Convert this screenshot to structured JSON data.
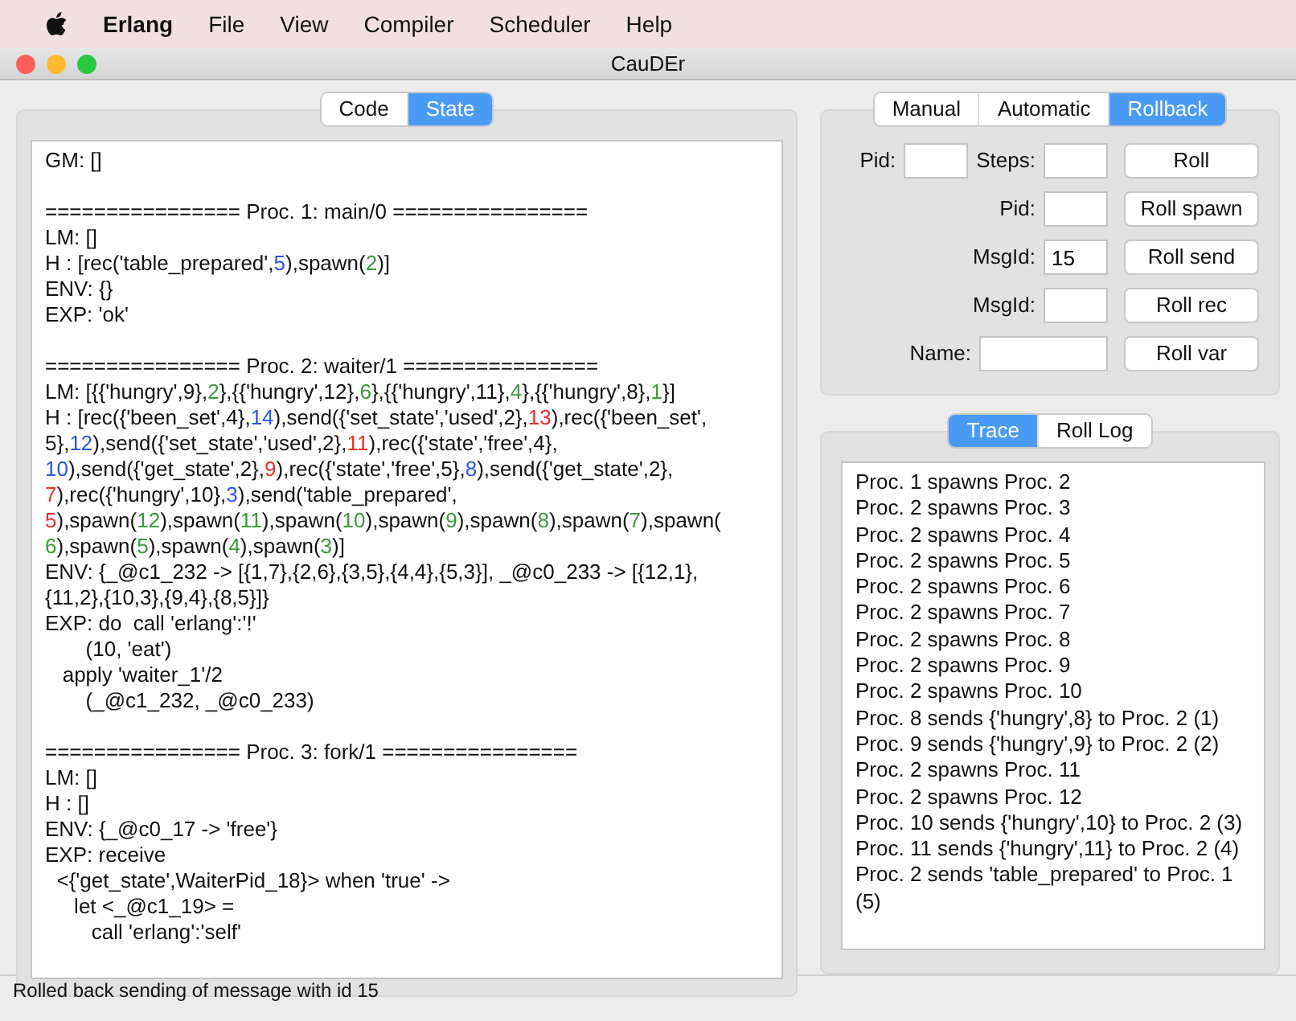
{
  "menu_bar": {
    "app": "Erlang",
    "items": [
      "File",
      "View",
      "Compiler",
      "Scheduler",
      "Help"
    ]
  },
  "window": {
    "title": "CauDEr"
  },
  "left_tabs": [
    {
      "label": "Code",
      "selected": false
    },
    {
      "label": "State",
      "selected": true
    }
  ],
  "state_sections": [
    {
      "lines": [
        [
          {
            "text": "GM: []"
          }
        ]
      ]
    },
    {
      "lines": [
        [
          {
            "text": "================ Proc. 1: main/0 ================"
          }
        ],
        [
          {
            "text": "LM: []"
          }
        ],
        [
          {
            "text": "H : [rec('table_prepared',"
          },
          {
            "text": "5",
            "color": "#2a56e0"
          },
          {
            "text": "),spawn("
          },
          {
            "text": "2",
            "color": "#3a9a3a"
          },
          {
            "text": ")]"
          }
        ],
        [
          {
            "text": "ENV: {}"
          }
        ],
        [
          {
            "text": "EXP: 'ok'"
          }
        ]
      ]
    },
    {
      "lines": [
        [
          {
            "text": "================ Proc. 2: waiter/1 ================"
          }
        ],
        [
          {
            "text": "LM: [{{'hungry',9},"
          },
          {
            "text": "2",
            "color": "#3a9a3a"
          },
          {
            "text": "},{{'hungry',12},"
          },
          {
            "text": "6",
            "color": "#3a9a3a"
          },
          {
            "text": "},{{'hungry',11},"
          },
          {
            "text": "4",
            "color": "#3a9a3a"
          },
          {
            "text": "},{{'hungry',8},"
          },
          {
            "text": "1",
            "color": "#3a9a3a"
          },
          {
            "text": "}]"
          }
        ],
        [
          {
            "text": "H : [rec({'been_set',4},"
          },
          {
            "text": "14",
            "color": "#2a56e0"
          },
          {
            "text": "),send({'set_state','used',2},"
          },
          {
            "text": "13",
            "color": "#e8302a"
          },
          {
            "text": "),rec({'been_set',"
          }
        ],
        [
          {
            "text": "5},"
          },
          {
            "text": "12",
            "color": "#2a56e0"
          },
          {
            "text": "),send({'set_state','used',2},"
          },
          {
            "text": "11",
            "color": "#e8302a"
          },
          {
            "text": "),rec({'state','free',4},"
          }
        ],
        [
          {
            "text": "10",
            "color": "#2a56e0"
          },
          {
            "text": "),send({'get_state',2},"
          },
          {
            "text": "9",
            "color": "#e8302a"
          },
          {
            "text": "),rec({'state','free',5},"
          },
          {
            "text": "8",
            "color": "#2a56e0"
          },
          {
            "text": "),send({'get_state',2},"
          }
        ],
        [
          {
            "text": "7",
            "color": "#e8302a"
          },
          {
            "text": "),rec({'hungry',10},"
          },
          {
            "text": "3",
            "color": "#2a56e0"
          },
          {
            "text": "),send('table_prepared',"
          }
        ],
        [
          {
            "text": "5",
            "color": "#e8302a"
          },
          {
            "text": "),spawn("
          },
          {
            "text": "12",
            "color": "#3a9a3a"
          },
          {
            "text": "),spawn("
          },
          {
            "text": "11",
            "color": "#3a9a3a"
          },
          {
            "text": "),spawn("
          },
          {
            "text": "10",
            "color": "#3a9a3a"
          },
          {
            "text": "),spawn("
          },
          {
            "text": "9",
            "color": "#3a9a3a"
          },
          {
            "text": "),spawn("
          },
          {
            "text": "8",
            "color": "#3a9a3a"
          },
          {
            "text": "),spawn("
          },
          {
            "text": "7",
            "color": "#3a9a3a"
          },
          {
            "text": "),spawn("
          }
        ],
        [
          {
            "text": "6",
            "color": "#3a9a3a"
          },
          {
            "text": "),spawn("
          },
          {
            "text": "5",
            "color": "#3a9a3a"
          },
          {
            "text": "),spawn("
          },
          {
            "text": "4",
            "color": "#3a9a3a"
          },
          {
            "text": "),spawn("
          },
          {
            "text": "3",
            "color": "#3a9a3a"
          },
          {
            "text": ")]"
          }
        ],
        [
          {
            "text": "ENV: {_@c1_232 -> [{1,7},{2,6},{3,5},{4,4},{5,3}], _@c0_233 -> [{12,1},"
          }
        ],
        [
          {
            "text": "{11,2},{10,3},{9,4},{8,5}]}"
          }
        ],
        [
          {
            "text": "EXP: do  call 'erlang':'!'"
          }
        ],
        [
          {
            "text": "       (10, 'eat')"
          }
        ],
        [
          {
            "text": "   apply 'waiter_1'/2"
          }
        ],
        [
          {
            "text": "       (_@c1_232, _@c0_233)"
          }
        ]
      ]
    },
    {
      "lines": [
        [
          {
            "text": "================ Proc. 3: fork/1 ================"
          }
        ],
        [
          {
            "text": "LM: []"
          }
        ],
        [
          {
            "text": "H : []"
          }
        ],
        [
          {
            "text": "ENV: {_@c0_17 -> 'free'}"
          }
        ],
        [
          {
            "text": "EXP: receive"
          }
        ],
        [
          {
            "text": "  <{'get_state',WaiterPid_18}> when 'true' ->"
          }
        ],
        [
          {
            "text": "     let <_@c1_19> ="
          }
        ],
        [
          {
            "text": "        call 'erlang':'self'"
          }
        ]
      ]
    }
  ],
  "mode_tabs": [
    {
      "label": "Manual",
      "selected": false
    },
    {
      "label": "Automatic",
      "selected": false
    },
    {
      "label": "Rollback",
      "selected": true
    }
  ],
  "rollback_rows": [
    {
      "fields": [
        {
          "label": "Pid:"
        },
        {
          "label": "Steps:"
        }
      ],
      "button": "Roll"
    },
    {
      "fields": [
        {
          "label": "Pid:"
        }
      ],
      "button": "Roll spawn"
    },
    {
      "fields": [
        {
          "label": "MsgId:",
          "value": "15"
        }
      ],
      "button": "Roll send"
    },
    {
      "fields": [
        {
          "label": "MsgId:"
        }
      ],
      "button": "Roll rec"
    },
    {
      "fields": [
        {
          "label": "Name:",
          "wide": true
        }
      ],
      "button": "Roll var"
    }
  ],
  "log_tabs": [
    {
      "label": "Trace",
      "selected": true
    },
    {
      "label": "Roll Log",
      "selected": false
    }
  ],
  "trace": [
    "Proc. 1 spawns Proc. 2",
    "Proc. 2 spawns Proc. 3",
    "Proc. 2 spawns Proc. 4",
    "Proc. 2 spawns Proc. 5",
    "Proc. 2 spawns Proc. 6",
    "Proc. 2 spawns Proc. 7",
    "Proc. 2 spawns Proc. 8",
    "Proc. 2 spawns Proc. 9",
    "Proc. 2 spawns Proc. 10",
    "Proc. 8 sends {'hungry',8} to Proc. 2 (1)",
    "Proc. 9 sends {'hungry',9} to Proc. 2 (2)",
    "Proc. 2 spawns Proc. 11",
    "Proc. 2 spawns Proc. 12",
    "Proc. 10 sends {'hungry',10} to Proc. 2 (3)",
    "Proc. 11 sends {'hungry',11} to Proc. 2 (4)",
    "Proc. 2 sends 'table_prepared' to Proc. 1 (5)"
  ],
  "status_bar": "Rolled back sending of message with id 15"
}
